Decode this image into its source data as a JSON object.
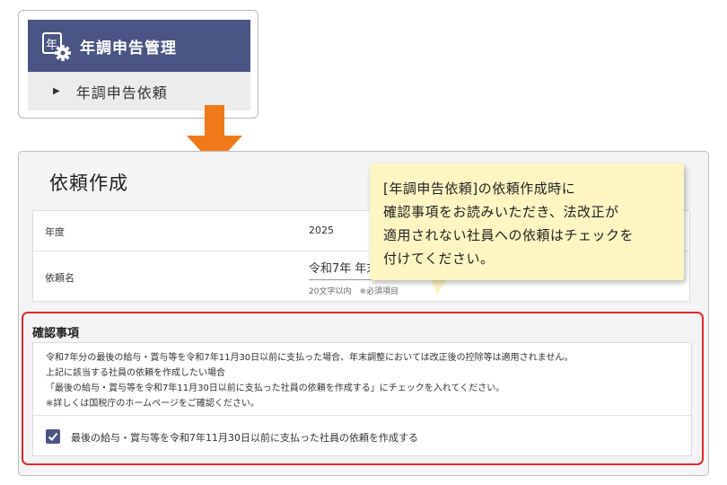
{
  "menu": {
    "header_icon_char": "年",
    "header_title": "年調申告管理",
    "sub_item_label": "年調申告依頼"
  },
  "main": {
    "page_title": "依頼作成",
    "year_label": "年度",
    "year_value": "2025",
    "request_name_label": "依頼名",
    "request_name_value": "令和7年 年末調整",
    "request_name_hint": "20文字以内　※必須項目"
  },
  "confirm": {
    "title": "確認事項",
    "lines": [
      "令和7年分の最後の給与・賞与等を令和7年11月30日以前に支払った場合、年末調整においては改正後の控除等は適用されません。",
      "上記に該当する社員の依頼を作成したい場合",
      "「最後の給与・賞与等を令和7年11月30日以前に支払った社員の依頼を作成する」にチェックを入れてください。",
      "※詳しくは国税庁のホームページをご確認ください。"
    ],
    "checkbox_label": "最後の給与・賞与等を令和7年11月30日以前に支払った社員の依頼を作成する",
    "checkbox_checked": true
  },
  "callout": {
    "lines": [
      "[年調申告依頼]の依頼作成時に",
      "確認事項をお読みいただき、法改正が",
      "適用されない社員への依頼はチェックを",
      "付けてください。"
    ]
  },
  "colors": {
    "menu_header": "#4a5585",
    "arrow": "#f07a1a",
    "highlight_border": "#e12a2a",
    "callout_bg": "#fdf6c3",
    "checkbox": "#4a5585"
  },
  "icons": {
    "menu_header_icon": "document-gear-icon",
    "sub_item_icon": "triangle-right-icon",
    "flow_arrow": "arrow-down-icon",
    "checkbox_mark": "checkmark-icon"
  }
}
